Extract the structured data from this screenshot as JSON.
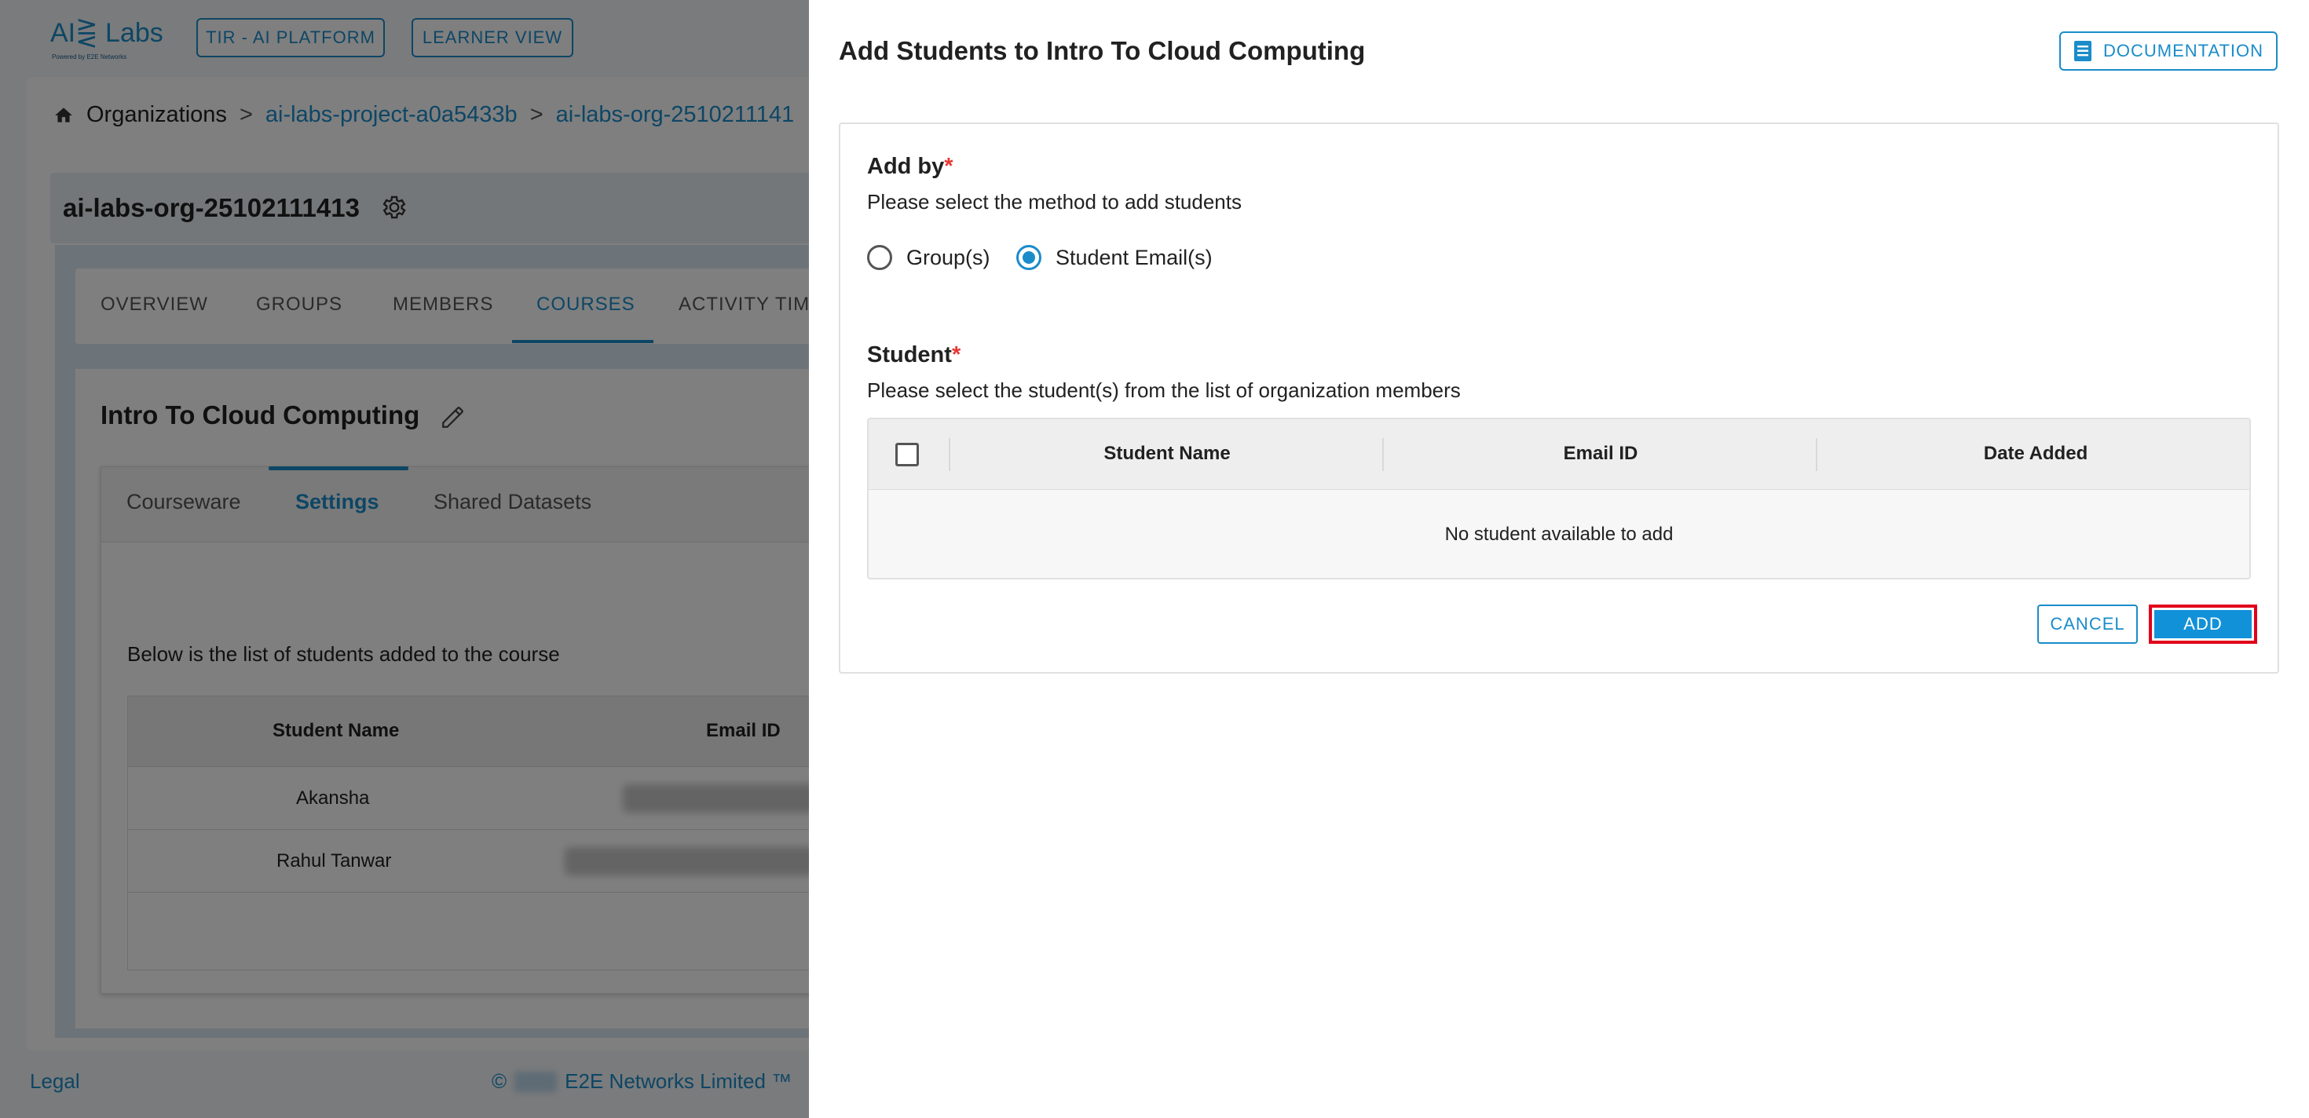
{
  "header": {
    "logo_text": "AI⋛ Labs",
    "logo_sub": "Powered by E2E Networks",
    "tir_button": "TIR - AI PLATFORM",
    "learner_button": "LEARNER VIEW"
  },
  "breadcrumb": {
    "root": "Organizations",
    "sep": ">",
    "project": "ai-labs-project-a0a5433b",
    "org": "ai-labs-org-2510211141"
  },
  "org": {
    "name": "ai-labs-org-25102111413"
  },
  "tabs": [
    "OVERVIEW",
    "GROUPS",
    "MEMBERS",
    "COURSES",
    "ACTIVITY TIME"
  ],
  "course": {
    "title": "Intro To Cloud Computing",
    "subtabs": [
      "Courseware",
      "Settings",
      "Shared Datasets"
    ],
    "list_desc": "Below is the list of students added to the course",
    "table_headers": [
      "Student Name",
      "Email ID"
    ],
    "students": [
      "Akansha",
      "Rahul Tanwar"
    ]
  },
  "footer": {
    "legal": "Legal",
    "copyright_symbol": "©",
    "company": "E2E Networks Limited ™"
  },
  "drawer": {
    "title": "Add Students to Intro To Cloud Computing",
    "documentation_button": "DOCUMENTATION",
    "add_by_label": "Add by",
    "add_by_hint": "Please select the method to add students",
    "required_mark": "*",
    "radio_options": [
      "Group(s)",
      "Student Email(s)"
    ],
    "selected_option": "Student Email(s)",
    "student_label": "Student",
    "student_hint": "Please select the student(s) from the list of organization members",
    "table_headers": [
      "Student Name",
      "Email ID",
      "Date Added"
    ],
    "empty_text": "No student available to add",
    "cancel_button": "CANCEL",
    "add_button": "ADD"
  },
  "colors": {
    "accent": "#1a8cca",
    "add_button": "#1191d8",
    "highlight": "#e0001a",
    "required": "#e53935"
  },
  "icons": [
    "home-icon",
    "gear-icon",
    "edit-pencil-icon",
    "document-list-icon",
    "checkbox-icon"
  ]
}
